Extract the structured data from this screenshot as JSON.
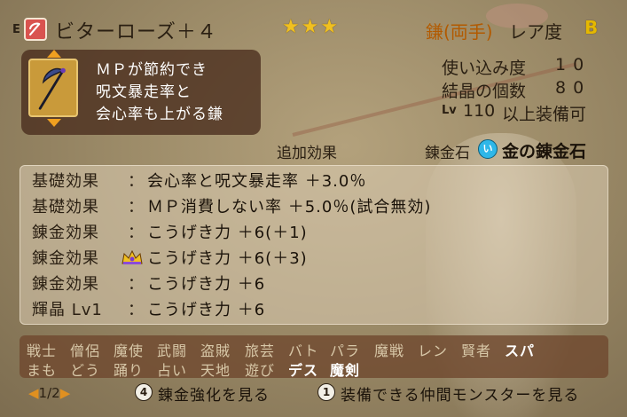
{
  "header": {
    "equip_mark": "E",
    "item_name": "ビターローズ＋４",
    "stars": "★★★",
    "weapon_type": "鎌(両手)",
    "rarity_label": "レア度",
    "rarity_value": "B"
  },
  "description": {
    "icon": "scythe-icon",
    "lines": [
      "ＭＰが節約でき",
      "呪文暴走率と",
      "会心率も上がる鎌"
    ]
  },
  "stats": {
    "usage_label": "使い込み度",
    "usage_value": "10",
    "crystal_label": "結晶の個数",
    "crystal_value": "80",
    "lv_tag": "Lv",
    "lv_value": "110",
    "lv_suffix": "以上装備可"
  },
  "extra_effects_label": "追加効果",
  "alchemy": {
    "label": "錬金石",
    "icon_text": "い",
    "value": "金の錬金石"
  },
  "effects": [
    {
      "label": "基礎効果",
      "value": "会心率と呪文暴走率 ＋3.0％",
      "crown": false
    },
    {
      "label": "基礎効果",
      "value": "ＭＰ消費しない率 ＋5.0％(試合無効)",
      "crown": false
    },
    {
      "label": "錬金効果",
      "value": "こうげき力 ＋6(＋1)",
      "crown": false
    },
    {
      "label": "錬金効果",
      "value": "こうげき力 ＋6(＋3)",
      "crown": true
    },
    {
      "label": "錬金効果",
      "value": "こうげき力 ＋6",
      "crown": false
    },
    {
      "label": "輝晶 Lv1",
      "value": "こうげき力 ＋6",
      "crown": false
    }
  ],
  "effect_colon": "：",
  "jobs_row1": [
    {
      "name": "戦士",
      "enabled": false
    },
    {
      "name": "僧侶",
      "enabled": false
    },
    {
      "name": "魔使",
      "enabled": false
    },
    {
      "name": "武闘",
      "enabled": false
    },
    {
      "name": "盗賊",
      "enabled": false
    },
    {
      "name": "旅芸",
      "enabled": false
    },
    {
      "name": "バト",
      "enabled": false
    },
    {
      "name": "パラ",
      "enabled": false
    },
    {
      "name": "魔戦",
      "enabled": false
    },
    {
      "name": "レン",
      "enabled": false
    },
    {
      "name": "賢者",
      "enabled": false
    },
    {
      "name": "スパ",
      "enabled": true
    }
  ],
  "jobs_row2": [
    {
      "name": "まも",
      "enabled": false
    },
    {
      "name": "どう",
      "enabled": false
    },
    {
      "name": "踊り",
      "enabled": false
    },
    {
      "name": "占い",
      "enabled": false
    },
    {
      "name": "天地",
      "enabled": false
    },
    {
      "name": "遊び",
      "enabled": false
    },
    {
      "name": "デス",
      "enabled": true
    },
    {
      "name": "魔剣",
      "enabled": true
    }
  ],
  "footer": {
    "page": "1/2",
    "alchemy_button_num": "4",
    "alchemy_button_label": "錬金強化を見る",
    "monster_button_num": "1",
    "monster_button_label": "装備できる仲間モンスターを見る"
  },
  "colors": {
    "rarity": "#e5b800",
    "weapon_type": "#b25a00",
    "stars": "#f0c020",
    "enabled_job": "#ffffff",
    "disabled_job": "#d8c8a8"
  }
}
